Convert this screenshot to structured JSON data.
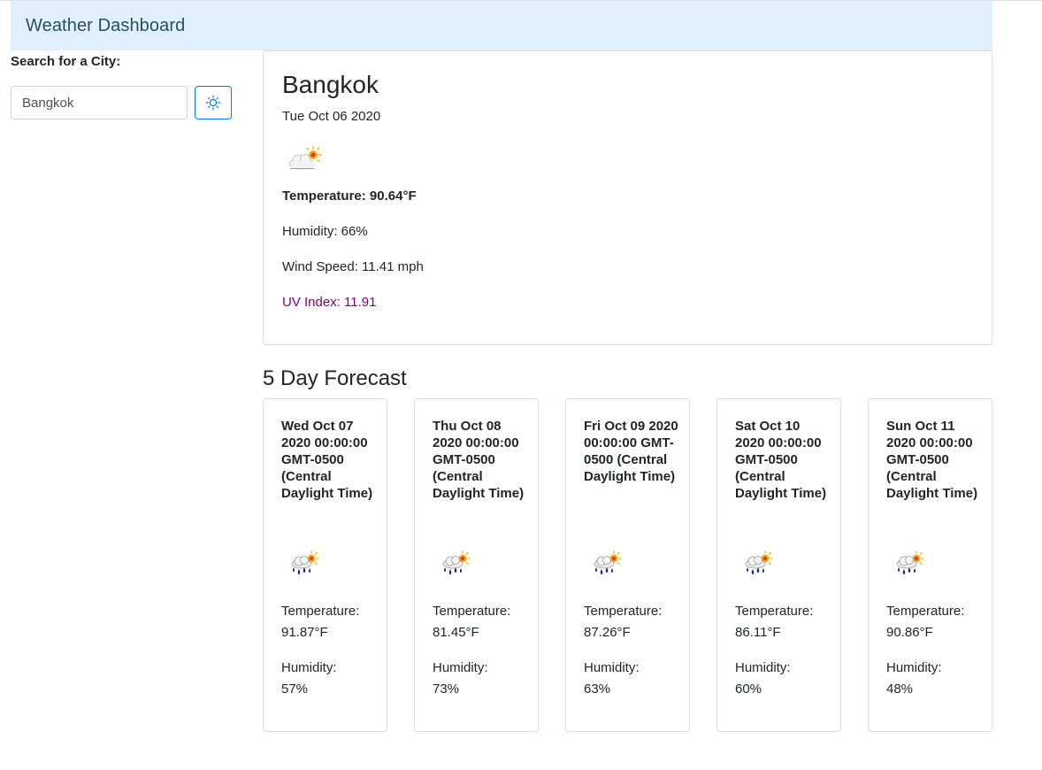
{
  "header": {
    "title": "Weather Dashboard"
  },
  "search": {
    "label": "Search for a City:",
    "value": "Bangkok",
    "button_icon": "sun-icon"
  },
  "current": {
    "city": "Bangkok",
    "date": "Tue Oct 06 2020",
    "icon": "cloud-sun-icon",
    "temperature": "Temperature: 90.64°F",
    "humidity": "Humidity: 66%",
    "wind": "Wind Speed: 11.41 mph",
    "uv": "UV Index: 11.91",
    "uv_color": "#800080"
  },
  "forecast": {
    "title": "5 Day Forecast",
    "temp_label": "Temperature:",
    "hum_label": "Humidity:",
    "days": [
      {
        "date": "Wed Oct 07 2020 00:00:00 GMT-0500 (Central Daylight Time)",
        "icon": "rain-sun-icon",
        "temp": "91.87°F",
        "humidity": "57%"
      },
      {
        "date": "Thu Oct 08 2020 00:00:00 GMT-0500 (Central Daylight Time)",
        "icon": "rain-sun-icon",
        "temp": "81.45°F",
        "humidity": "73%"
      },
      {
        "date": "Fri Oct 09 2020 00:00:00 GMT-0500 (Central Daylight Time)",
        "icon": "rain-sun-icon",
        "temp": "87.26°F",
        "humidity": "63%"
      },
      {
        "date": "Sat Oct 10 2020 00:00:00 GMT-0500 (Central Daylight Time)",
        "icon": "rain-sun-icon",
        "temp": "86.11°F",
        "humidity": "60%"
      },
      {
        "date": "Sun Oct 11 2020 00:00:00 GMT-0500 (Central Daylight Time)",
        "icon": "rain-sun-icon",
        "temp": "90.86°F",
        "humidity": "48%"
      }
    ]
  }
}
